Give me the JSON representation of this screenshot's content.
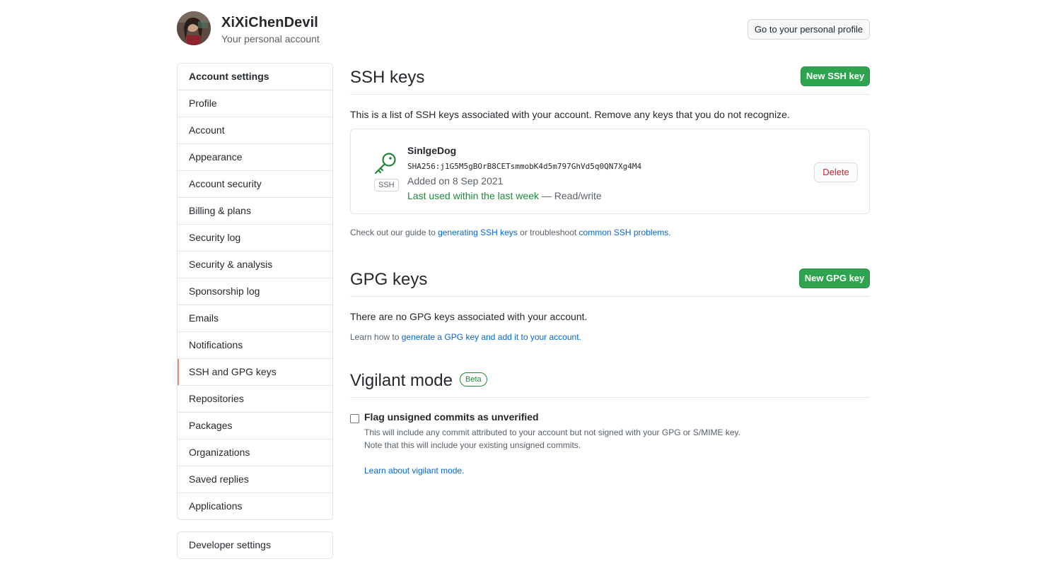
{
  "user": {
    "name": "XiXiChenDevil",
    "subtitle": "Your personal account",
    "profile_button": "Go to your personal profile"
  },
  "sidebar": {
    "heading": "Account settings",
    "items": [
      {
        "label": "Profile"
      },
      {
        "label": "Account"
      },
      {
        "label": "Appearance"
      },
      {
        "label": "Account security"
      },
      {
        "label": "Billing & plans"
      },
      {
        "label": "Security log"
      },
      {
        "label": "Security & analysis"
      },
      {
        "label": "Sponsorship log"
      },
      {
        "label": "Emails"
      },
      {
        "label": "Notifications"
      },
      {
        "label": "SSH and GPG keys",
        "selected": true
      },
      {
        "label": "Repositories"
      },
      {
        "label": "Packages"
      },
      {
        "label": "Organizations"
      },
      {
        "label": "Saved replies"
      },
      {
        "label": "Applications"
      }
    ],
    "developer": "Developer settings"
  },
  "ssh": {
    "title": "SSH keys",
    "new_button": "New SSH key",
    "description": "This is a list of SSH keys associated with your account. Remove any keys that you do not recognize.",
    "key": {
      "badge": "SSH",
      "name": "SinlgeDog",
      "fingerprint": "SHA256:j1G5M5gBOrB8CETsmmobK4d5m797GhVd5q0QN7Xg4M4",
      "added": "Added on 8 Sep 2021",
      "last_used": "Last used within the last week",
      "access": " — Read/write",
      "delete_button": "Delete"
    },
    "guide_prefix": "Check out our guide to ",
    "guide_link1": "generating SSH keys",
    "guide_mid": " or troubleshoot ",
    "guide_link2": "common SSH problems",
    "guide_suffix": "."
  },
  "gpg": {
    "title": "GPG keys",
    "new_button": "New GPG key",
    "empty": "There are no GPG keys associated with your account.",
    "learn_prefix": "Learn how to ",
    "learn_link": "generate a GPG key and add it to your account",
    "learn_suffix": "."
  },
  "vigilant": {
    "title": "Vigilant mode",
    "badge": "Beta",
    "checkbox_label": "Flag unsigned commits as unverified",
    "checked": false,
    "note1": "This will include any commit attributed to your account but not signed with your GPG or S/MIME key.",
    "note2": "Note that this will include your existing unsigned commits.",
    "learn_link": "Learn about vigilant mode",
    "learn_suffix": "."
  },
  "colors": {
    "green": "#2ea44f",
    "link": "#0366d6",
    "selected_accent": "#f9826c",
    "danger": "#cb2431"
  }
}
